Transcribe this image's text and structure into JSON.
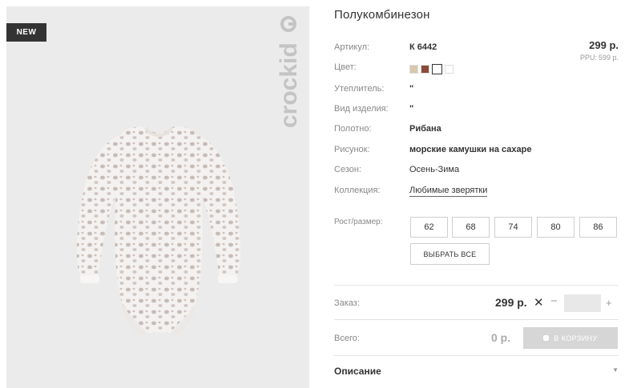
{
  "badge": "NEW",
  "brand": "crockid",
  "product": {
    "title": "Полукомбинезон",
    "price": "299 р.",
    "ppu_label": "PPU:",
    "ppu_value": "599 р."
  },
  "attributes": [
    {
      "label": "Артикул:",
      "value": "К 6442"
    },
    {
      "label": "Цвет:",
      "value": ""
    },
    {
      "label": "Утеплитель:",
      "value": "\""
    },
    {
      "label": "Вид изделия:",
      "value": "\""
    },
    {
      "label": "Полотно:",
      "value": "Рибана"
    },
    {
      "label": "Рисунок:",
      "value": "морские камушки на сахаре"
    },
    {
      "label": "Сезон:",
      "value": "Осень-Зима"
    },
    {
      "label": "Коллекция:",
      "value": "Любимые зверятки"
    }
  ],
  "colors": [
    "#d8c8ad",
    "#8b4a3a",
    "#ffffff",
    "#ffffff"
  ],
  "sizes": {
    "label": "Рост/размер:",
    "options": [
      "62",
      "68",
      "74",
      "80",
      "86"
    ],
    "select_all": "ВЫБРАТЬ ВСЕ"
  },
  "order": {
    "label": "Заказ:",
    "price": "299 р.",
    "times": "✕",
    "minus": "−",
    "plus": "+",
    "quantity": ""
  },
  "total": {
    "label": "Всего:",
    "value": "0 р.",
    "cart_button": "В КОРЗИНУ"
  },
  "description": {
    "label": "Описание",
    "arrow": "▼"
  }
}
